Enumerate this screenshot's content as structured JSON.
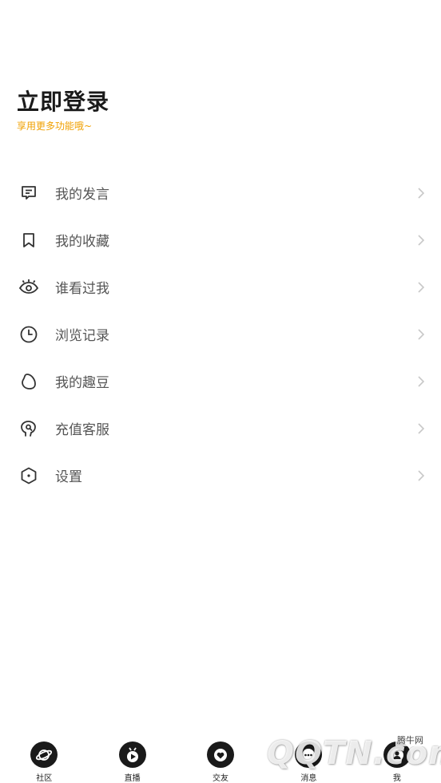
{
  "header": {
    "title": "立即登录",
    "subtitle": "享用更多功能哦~"
  },
  "menu": {
    "items": [
      {
        "label": "我的发言",
        "icon": "comment-icon"
      },
      {
        "label": "我的收藏",
        "icon": "bookmark-icon"
      },
      {
        "label": "谁看过我",
        "icon": "eye-icon"
      },
      {
        "label": "浏览记录",
        "icon": "clock-icon"
      },
      {
        "label": "我的趣豆",
        "icon": "bean-icon"
      },
      {
        "label": "充值客服",
        "icon": "customer-service-icon"
      },
      {
        "label": "设置",
        "icon": "settings-icon"
      }
    ]
  },
  "tabbar": {
    "tabs": [
      {
        "label": "社区",
        "icon": "community-icon"
      },
      {
        "label": "直播",
        "icon": "live-play-icon"
      },
      {
        "label": "交友",
        "icon": "heart-icon"
      },
      {
        "label": "消息",
        "icon": "message-icon"
      },
      {
        "label": "我",
        "icon": "me-icon"
      }
    ]
  },
  "watermark": {
    "logo": "QQTN.com",
    "site": "腾牛网"
  },
  "colors": {
    "accent": "#f0a000",
    "title": "#1a1a1a",
    "label": "#555555",
    "tab_icon_bg": "#1a1a1a"
  }
}
